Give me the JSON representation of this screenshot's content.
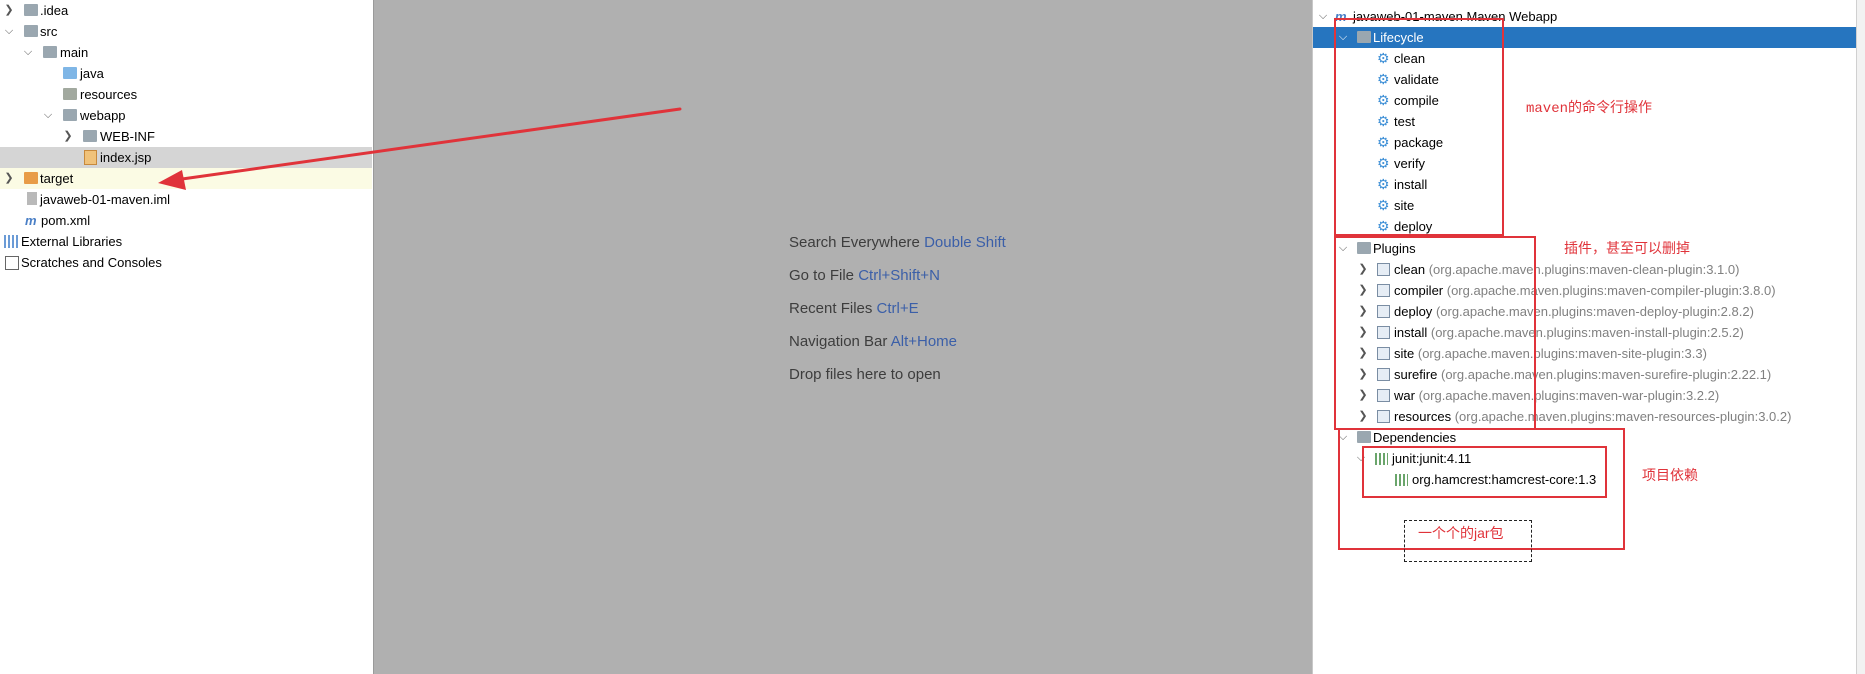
{
  "project_tree": {
    "items": [
      {
        "label": ".idea"
      },
      {
        "label": "src"
      },
      {
        "label": "main"
      },
      {
        "label": "java"
      },
      {
        "label": "resources"
      },
      {
        "label": "webapp"
      },
      {
        "label": "WEB-INF"
      },
      {
        "label": "index.jsp"
      },
      {
        "label": "target"
      },
      {
        "label": "javaweb-01-maven.iml"
      },
      {
        "label": "pom.xml"
      },
      {
        "label": "External Libraries"
      },
      {
        "label": "Scratches and Consoles"
      }
    ]
  },
  "editor": {
    "tips": [
      {
        "text": "Search Everywhere",
        "key": "Double Shift"
      },
      {
        "text": "Go to File",
        "key": "Ctrl+Shift+N"
      },
      {
        "text": "Recent Files",
        "key": "Ctrl+E"
      },
      {
        "text": "Navigation Bar",
        "key": "Alt+Home"
      },
      {
        "text": "Drop files here to open",
        "key": ""
      }
    ]
  },
  "maven": {
    "root": "javaweb-01-maven Maven Webapp",
    "lifecycle": {
      "label": "Lifecycle",
      "phases": [
        "clean",
        "validate",
        "compile",
        "test",
        "package",
        "verify",
        "install",
        "site",
        "deploy"
      ]
    },
    "plugins": {
      "label": "Plugins",
      "items": [
        {
          "name": "clean",
          "coord": "(org.apache.maven.plugins:maven-clean-plugin:3.1.0)"
        },
        {
          "name": "compiler",
          "coord": "(org.apache.maven.plugins:maven-compiler-plugin:3.8.0)"
        },
        {
          "name": "deploy",
          "coord": "(org.apache.maven.plugins:maven-deploy-plugin:2.8.2)"
        },
        {
          "name": "install",
          "coord": "(org.apache.maven.plugins:maven-install-plugin:2.5.2)"
        },
        {
          "name": "site",
          "coord": "(org.apache.maven.plugins:maven-site-plugin:3.3)"
        },
        {
          "name": "surefire",
          "coord": "(org.apache.maven.plugins:maven-surefire-plugin:2.22.1)"
        },
        {
          "name": "war",
          "coord": "(org.apache.maven.plugins:maven-war-plugin:3.2.2)"
        },
        {
          "name": "resources",
          "coord": "(org.apache.maven.plugins:maven-resources-plugin:3.0.2)"
        }
      ]
    },
    "dependencies": {
      "label": "Dependencies",
      "items": [
        "junit:junit:4.11",
        "org.hamcrest:hamcrest-core:1.3"
      ]
    }
  },
  "annotations": {
    "lifecycle_note": "maven的命令行操作",
    "plugins_note": "插件，甚至可以删掉",
    "deps_note": "项目依赖",
    "jar_note": "一个个的jar包"
  },
  "colors": {
    "annotation": "#e0333a",
    "selection": "#2675bf",
    "editor_bg": "#b0b0b0",
    "shortcut": "#3b5fa8"
  }
}
